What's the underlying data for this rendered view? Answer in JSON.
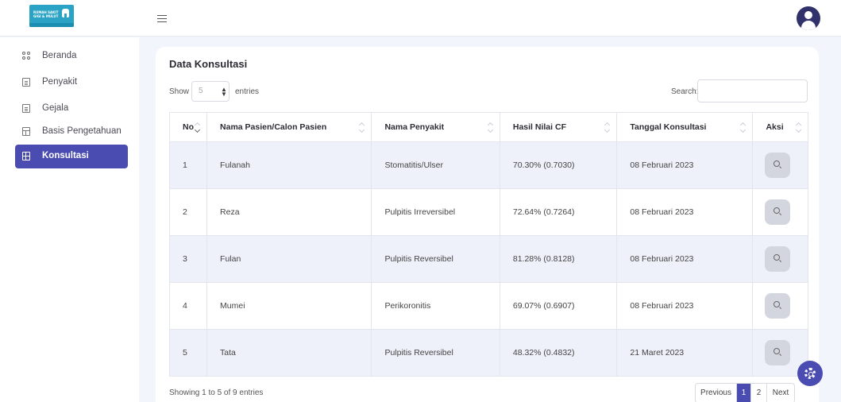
{
  "header": {
    "logo_text": "RUMAH SAKIT GIGI & MULUT",
    "menu_icon": "hamburger-icon",
    "avatar_icon": "user-avatar-icon"
  },
  "sidebar": {
    "items": [
      {
        "label": "Beranda",
        "icon": "dashboard-icon",
        "active": false
      },
      {
        "label": "Penyakit",
        "icon": "document-icon",
        "active": false
      },
      {
        "label": "Gejala",
        "icon": "document-icon",
        "active": false
      },
      {
        "label": "Basis Pengetahuan",
        "icon": "table-icon",
        "active": false
      },
      {
        "label": "Konsultasi",
        "icon": "grid-icon",
        "active": true
      }
    ]
  },
  "main": {
    "title": "Data Konsultasi",
    "show_label": "Show",
    "entries_value": "5",
    "entries_label": "entries",
    "search_label": "Search:",
    "search_value": "",
    "columns": [
      "No",
      "Nama Pasien/Calon Pasien",
      "Nama Penyakit",
      "Hasil Nilai CF",
      "Tanggal Konsultasi",
      "Aksi"
    ],
    "rows": [
      {
        "no": "1",
        "nama": "Fulanah",
        "penyakit": "Stomatitis/Ulser",
        "cf": "70.30% (0.7030)",
        "tanggal": "08 Februari 2023"
      },
      {
        "no": "2",
        "nama": "Reza",
        "penyakit": "Pulpitis Irreversibel",
        "cf": "72.64% (0.7264)",
        "tanggal": "08 Februari 2023"
      },
      {
        "no": "3",
        "nama": "Fulan",
        "penyakit": "Pulpitis Reversibel",
        "cf": "81.28% (0.8128)",
        "tanggal": "08 Februari 2023"
      },
      {
        "no": "4",
        "nama": "Mumei",
        "penyakit": "Perikoronitis",
        "cf": "69.07% (0.6907)",
        "tanggal": "08 Februari 2023"
      },
      {
        "no": "5",
        "nama": "Tata",
        "penyakit": "Pulpitis Reversibel",
        "cf": "48.32% (0.4832)",
        "tanggal": "21 Maret 2023"
      }
    ],
    "showing_text": "Showing 1 to 5 of 9 entries",
    "pagination": {
      "previous": "Previous",
      "pages": [
        "1",
        "2"
      ],
      "active_page": "1",
      "next": "Next"
    }
  },
  "colors": {
    "accent": "#4b4cb2",
    "row_stripe": "#eef1f9",
    "page_bg": "#f2f5fc",
    "avatar": "#31326b"
  }
}
